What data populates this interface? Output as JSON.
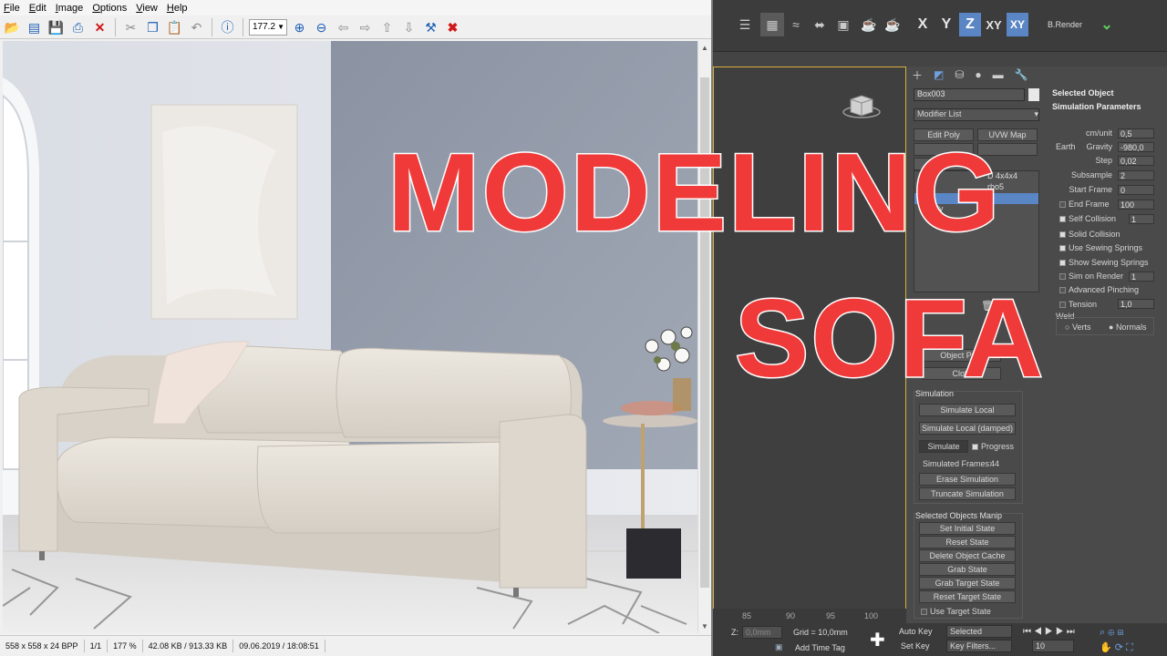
{
  "viewer": {
    "menu": [
      "File",
      "Edit",
      "Image",
      "Options",
      "View",
      "Help"
    ],
    "zoom_value": "177.2",
    "status": {
      "dimensions": "558 x 558 x 24 BPP",
      "page": "1/1",
      "zoom": "177 %",
      "size": "42.08 KB / 913.33 KB",
      "datetime": "09.06.2019 / 18:08:51"
    }
  },
  "title": {
    "line1": "MODELING",
    "line2": "SOFA"
  },
  "max": {
    "axes": [
      "X",
      "Y",
      "Z",
      "XY",
      "XY"
    ],
    "brender_label": "B.Render",
    "object_name": "Box003",
    "modifier_list": "Modifier List",
    "modifier_buttons": [
      "Edit Poly",
      "UVW Map"
    ],
    "stack_items": [
      "D 4x4x4",
      "rbo5",
      "Poly"
    ],
    "object_props": "Object Prop",
    "cloth": "Cloth",
    "simulation": {
      "title": "Simulation",
      "simulate_local": "Simulate Local",
      "simulate_local_damped": "Simulate Local (damped)",
      "simulate": "Simulate",
      "progress": "Progress",
      "simulated_frames_label": "Simulated Frames:",
      "simulated_frames_value": "44",
      "erase": "Erase Simulation",
      "truncate": "Truncate Simulation"
    },
    "manip": {
      "title": "Selected Objects Manip",
      "buttons": [
        "Set Initial State",
        "Reset State",
        "Delete Object Cache",
        "Grab State",
        "Grab Target State",
        "Reset Target State"
      ],
      "use_target_state": "Use Target State"
    },
    "params": {
      "selected_object": "Selected Object",
      "sim_params": "Simulation Parameters",
      "cm_unit_label": "cm/unit",
      "cm_unit": "0,5",
      "earth": "Earth",
      "gravity_label": "Gravity",
      "gravity": "-980,0",
      "step_label": "Step",
      "step": "0,02",
      "subsample_label": "Subsample",
      "subsample": "2",
      "start_frame_label": "Start Frame",
      "start_frame": "0",
      "end_frame_label": "End Frame",
      "end_frame": "100",
      "self_collision_label": "Self Collision",
      "self_collision": "1",
      "solid_collision": "Solid Collision",
      "use_sewing_springs": "Use Sewing Springs",
      "show_sewing_springs": "Show Sewing Springs",
      "sim_on_render_label": "Sim on Render",
      "sim_on_render": "1",
      "advanced_pinching": "Advanced Pinching",
      "tension_label": "Tension",
      "tension": "1,0",
      "weld": "Weld",
      "verts": "Verts",
      "normals": "Normals"
    },
    "ruler": [
      "85",
      "90",
      "95",
      "100"
    ],
    "bottom": {
      "z_label": "Z:",
      "z_value": "0,0mm",
      "grid": "Grid = 10,0mm",
      "add_time_tag": "Add Time Tag",
      "auto_key": "Auto Key",
      "set_key": "Set Key",
      "selected": "Selected",
      "key_filters": "Key Filters...",
      "frame": "10"
    }
  }
}
